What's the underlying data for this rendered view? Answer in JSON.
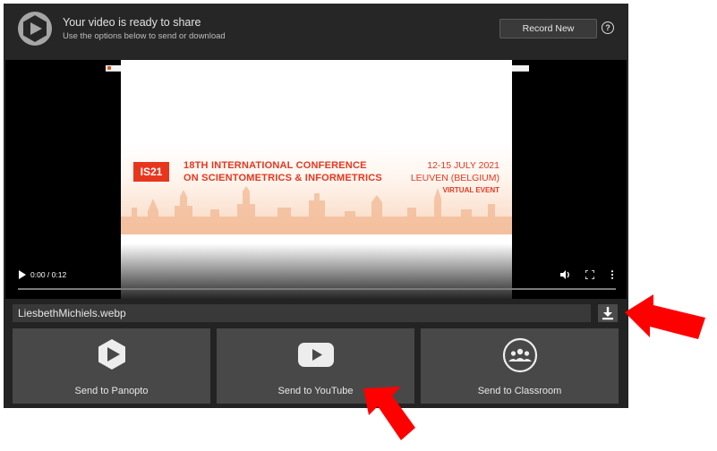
{
  "header": {
    "title": "Your video is ready to share",
    "subtitle": "Use the options below to send or download",
    "record_label": "Record New",
    "help_label": "?"
  },
  "video": {
    "logo_text": "IS21",
    "conference_line1": "18TH INTERNATIONAL CONFERENCE",
    "conference_line2": "ON SCIENTOMETRICS & INFORMETRICS",
    "date_line1": "12-15 JULY 2021",
    "date_line2": "LEUVEN (BELGIUM)",
    "date_line3": "VIRTUAL EVENT",
    "time_display": "0:00 / 0:12",
    "progress_fraction": 0.0
  },
  "file": {
    "name": "LiesbethMichiels.webp"
  },
  "share_options": [
    {
      "label": "Send to Panopto",
      "icon": "panopto-icon"
    },
    {
      "label": "Send to YouTube",
      "icon": "youtube-icon"
    },
    {
      "label": "Send to Classroom",
      "icon": "classroom-icon"
    }
  ],
  "colors": {
    "accent_red": "#e8361e",
    "annotation_arrow": "#ff0000",
    "panel_bg": "#232323",
    "tile_bg": "#484848"
  }
}
